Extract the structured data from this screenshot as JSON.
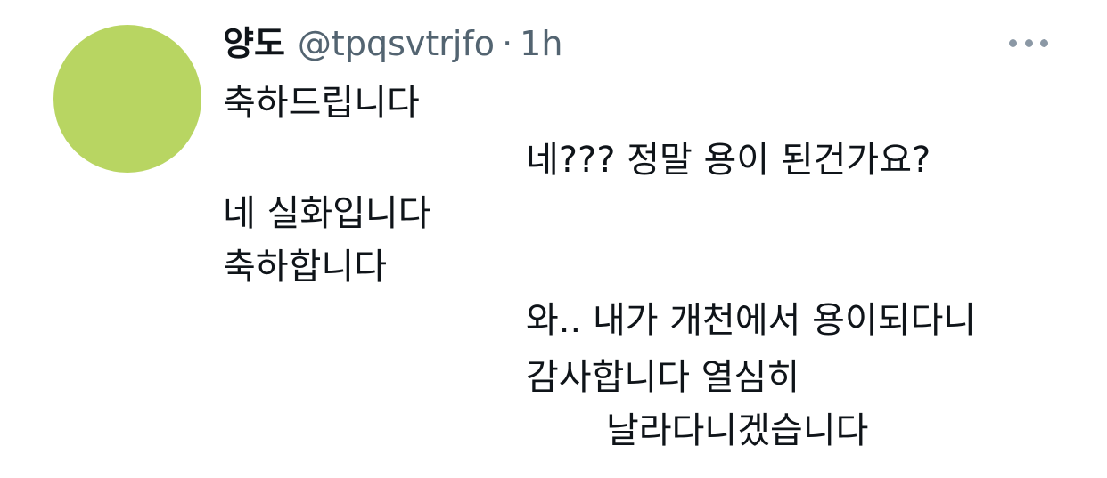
{
  "tweet": {
    "display_name": "양도",
    "handle": "@tpqsvtrjfo",
    "separator": "·",
    "time": "1h",
    "lines": [
      "축하드립니다",
      "네??? 정말 용이 된건가요?",
      "네 실화입니다",
      "축하합니다",
      "와.. 내가 개천에서 용이되다니",
      "감사합니다 열심히",
      "날라다니겠습니다"
    ]
  },
  "colors": {
    "avatar": "#b8d562",
    "text": "#0f1419",
    "secondary": "#536471",
    "more_dots": "#8b98a5"
  },
  "icons": {
    "more": "more-horizontal-icon"
  }
}
